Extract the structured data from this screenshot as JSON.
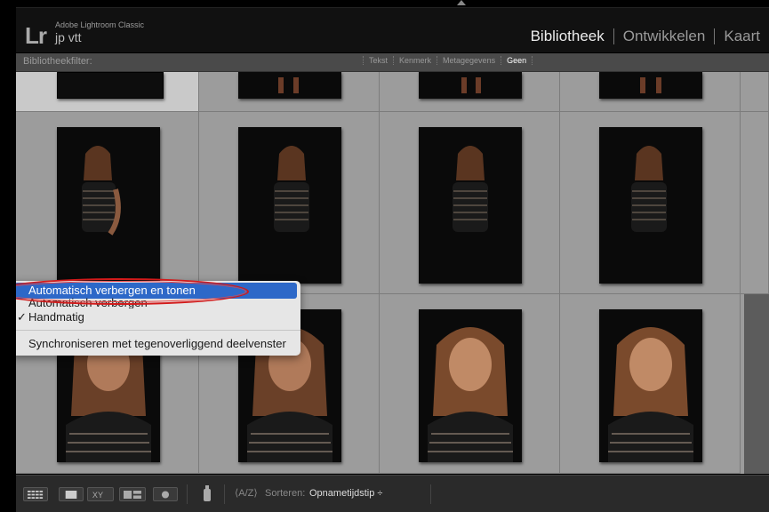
{
  "identity": {
    "logo": "Lr",
    "app_name": "Adobe Lightroom Classic",
    "user": "jp vtt"
  },
  "modules": [
    {
      "label": "Bibliotheek",
      "active": true
    },
    {
      "label": "Ontwikkelen",
      "active": false
    },
    {
      "label": "Kaart",
      "active": false
    }
  ],
  "filter_bar": {
    "label": "Bibliotheekfilter:",
    "options": [
      {
        "label": "Tekst",
        "active": false
      },
      {
        "label": "Kenmerk",
        "active": false
      },
      {
        "label": "Metagegevens",
        "active": false
      },
      {
        "label": "Geen",
        "active": true
      }
    ]
  },
  "context_menu": {
    "items": [
      {
        "label": "Automatisch verbergen en tonen",
        "highlighted": true,
        "checked": false
      },
      {
        "label": "Automatisch verbergen",
        "highlighted": false,
        "checked": false
      },
      {
        "label": "Handmatig",
        "highlighted": false,
        "checked": true
      },
      {
        "label": "Synchroniseren met tegenoverliggend deelvenster",
        "highlighted": false,
        "checked": false
      }
    ],
    "check_glyph": "✓"
  },
  "toolbar": {
    "buttons": [
      "grid-view-icon",
      "loupe-view-icon",
      "compare-view-icon",
      "survey-view-icon",
      "people-view-icon",
      "painter-icon",
      "sort-direction-icon"
    ],
    "sort_label": "Sorteren:",
    "sort_value": "Opnametijdstip ÷",
    "sort_direction_glyph": "⟨A/Z⟩"
  },
  "colors": {
    "menu_highlight": "#2d68c8",
    "annotation": "#d21a1a",
    "grid_background": "#9c9c9c"
  }
}
